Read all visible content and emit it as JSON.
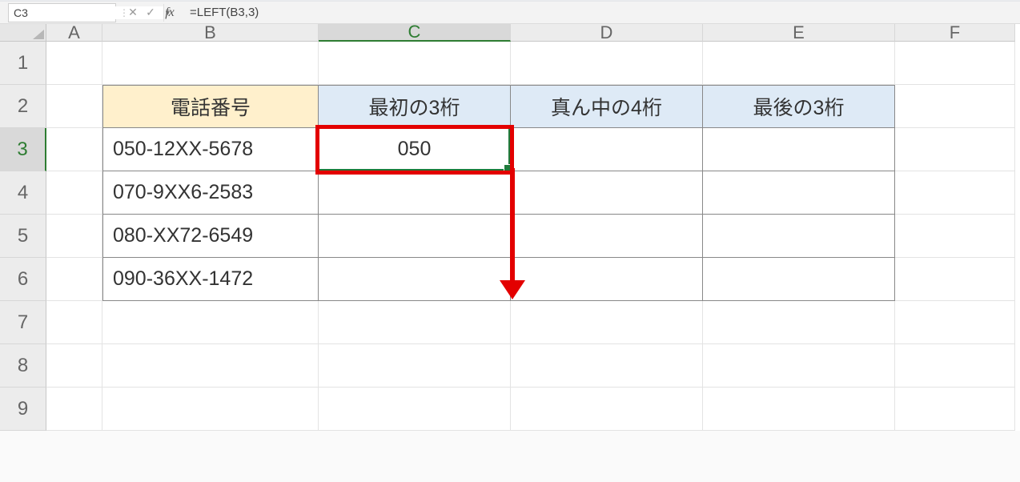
{
  "nameBox": "C3",
  "formula": "=LEFT(B3,3)",
  "fxGlyph": "fx",
  "cancelGlyph": "✕",
  "confirmGlyph": "✓",
  "dropdownGlyph": "▼",
  "dotsGlyph": "⋮",
  "columns": [
    {
      "id": "A",
      "label": "A",
      "wclass": "w-A"
    },
    {
      "id": "B",
      "label": "B",
      "wclass": "w-B"
    },
    {
      "id": "C",
      "label": "C",
      "wclass": "w-C"
    },
    {
      "id": "D",
      "label": "D",
      "wclass": "w-D"
    },
    {
      "id": "E",
      "label": "E",
      "wclass": "w-E"
    },
    {
      "id": "F",
      "label": "F",
      "wclass": "w-F"
    }
  ],
  "activeColumn": "C",
  "activeRow": 3,
  "headerRowIndex": 2,
  "headers": {
    "B": "電話番号",
    "C": "最初の3桁",
    "D": "真ん中の4桁",
    "E": "最後の3桁"
  },
  "dataRows": [
    {
      "row": 3,
      "phone": "050-12XX-5678",
      "first3": "050",
      "mid4": "",
      "last3": ""
    },
    {
      "row": 4,
      "phone": "070-9XX6-2583",
      "first3": "",
      "mid4": "",
      "last3": ""
    },
    {
      "row": 5,
      "phone": "080-XX72-6549",
      "first3": "",
      "mid4": "",
      "last3": ""
    },
    {
      "row": 6,
      "phone": "090-36XX-1472",
      "first3": "",
      "mid4": "",
      "last3": ""
    }
  ],
  "totalVisibleRows": 9,
  "annotation": {
    "redBoxCell": {
      "col": "C",
      "row": 3
    },
    "arrow": {
      "fromCol": "C",
      "fromRow": 3,
      "toRow": 6
    }
  },
  "colors": {
    "activeGreen": "#1f7b3c",
    "red": "#e30000",
    "hdrYellow": "#fff0cc",
    "hdrBlue": "#deeaf6"
  }
}
